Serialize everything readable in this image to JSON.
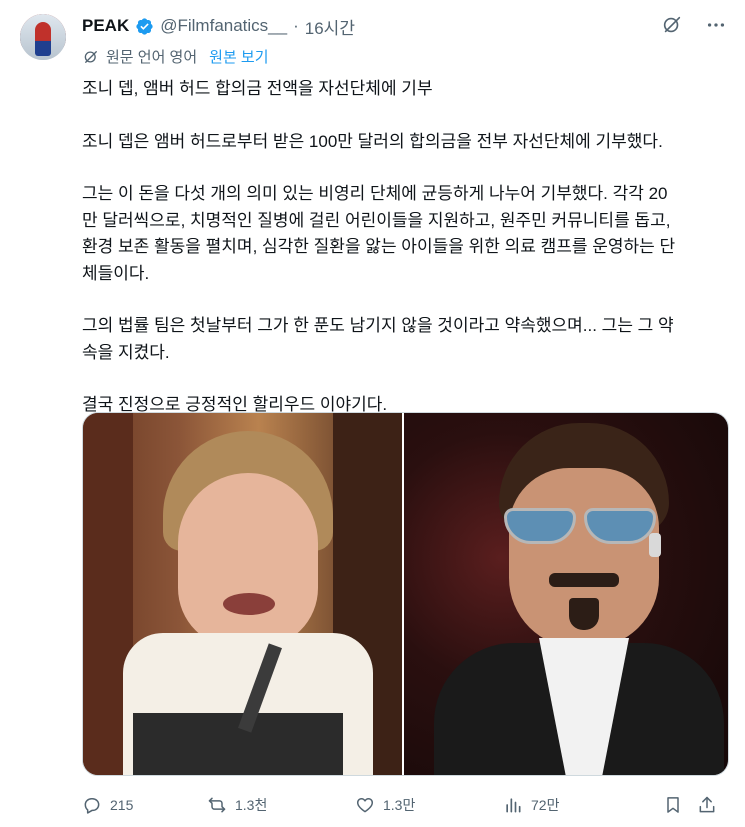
{
  "user": {
    "name": "PEAK",
    "handle": "@Filmfanatics__",
    "separator": "·",
    "time": "16시간"
  },
  "translation": {
    "label": "원문 언어 영어",
    "show_original": "원본 보기"
  },
  "tweet": {
    "paragraphs": [
      "조니 뎁, 앰버 허드 합의금 전액을 자선단체에 기부",
      "조니 뎁은 앰버 허드로부터 받은 100만 달러의 합의금을 전부 자선단체에 기부했다.",
      "그는 이 돈을 다섯 개의 의미 있는 비영리 단체에 균등하게 나누어 기부했다. 각각 20\n만 달러씩으로, 치명적인 질병에 걸린 어린이들을 지원하고, 원주민 커뮤니티를 돕고,\n환경 보존 활동을 펼치며, 심각한 질환을 앓는 아이들을 위한 의료 캠프를 운영하는 단\n체들이다.",
      "그의 법률 팀은 첫날부터 그가 한 푼도 남기지 않을 것이라고 약속했으며... 그는 그 약\n속을 지켰다.",
      "결국 진정으로 긍정적인 할리우드 이야기다."
    ]
  },
  "actions": {
    "replies": "215",
    "reposts": "1.3천",
    "likes": "1.3만",
    "views": "72만"
  },
  "icons": {
    "verified": "verified-badge-icon",
    "grok": "grok-icon",
    "more": "more-icon",
    "translate": "translate-icon",
    "reply": "reply-icon",
    "repost": "repost-icon",
    "like": "heart-icon",
    "views": "views-icon",
    "bookmark": "bookmark-icon",
    "share": "share-icon"
  },
  "colors": {
    "text": "#0f1419",
    "secondary": "#536471",
    "accent": "#1d9bf0",
    "border": "#cfd9de"
  }
}
